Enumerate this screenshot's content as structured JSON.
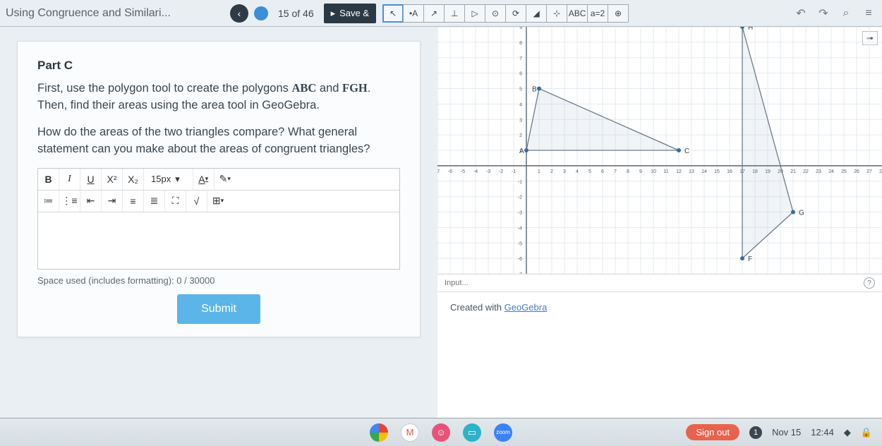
{
  "header": {
    "title": "Using Congruence and Similari...",
    "page": "15 of 46",
    "save": "Save &"
  },
  "ggb_tools": [
    "↖",
    "•A",
    "↗",
    "⊥",
    "▷",
    "⊙",
    "⟳",
    "◢",
    "⊹",
    "ABC",
    "a=2",
    "⊕"
  ],
  "top_right": {
    "undo": "↶",
    "redo": "↷",
    "search": "⌕",
    "menu": "≡"
  },
  "part": {
    "label": "Part C",
    "p1a": "First, use the polygon tool to create the polygons ",
    "p1b": "ABC",
    "p1c": " and ",
    "p1d": "FGH",
    "p1e": ". Then, find their areas using the area tool in GeoGebra.",
    "p2": "How do the areas of the two triangles compare? What general statement can you make about the areas of congruent triangles?"
  },
  "editor": {
    "bold": "B",
    "italic": "I",
    "underline": "U",
    "sup": "X²",
    "sub": "X₂",
    "font": "15px",
    "fontcolor": "A",
    "highlight": "✎",
    "ul": "≔",
    "ol": "⋮≡",
    "outdent": "⇤",
    "indent": "⇥",
    "center": "≡",
    "justify": "≣",
    "image": "⛶",
    "formula": "√",
    "table": "⊞"
  },
  "space_used": "Space used (includes formatting): 0 / 30000",
  "submit": "Submit",
  "ggb": {
    "input_placeholder": "Input...",
    "credit_prefix": "Created with ",
    "credit_link": "GeoGebra",
    "labels": {
      "A": "A",
      "B": "B",
      "C": "C",
      "F": "F",
      "G": "G",
      "H": "H"
    }
  },
  "chart_data": {
    "type": "scatter",
    "title": "",
    "xlabel": "",
    "ylabel": "",
    "xlim": [
      -7,
      28
    ],
    "ylim": [
      -7,
      9
    ],
    "series": [
      {
        "name": "Triangle ABC",
        "points": {
          "A": [
            0,
            1
          ],
          "B": [
            1,
            5
          ],
          "C": [
            12,
            1
          ]
        }
      },
      {
        "name": "Triangle FGH",
        "points": {
          "F": [
            17,
            -6
          ],
          "G": [
            21,
            -3
          ],
          "H": [
            17,
            9
          ]
        }
      }
    ]
  },
  "taskbar": {
    "signout": "Sign out",
    "notif": "1",
    "date": "Nov 15",
    "time": "12:44"
  }
}
